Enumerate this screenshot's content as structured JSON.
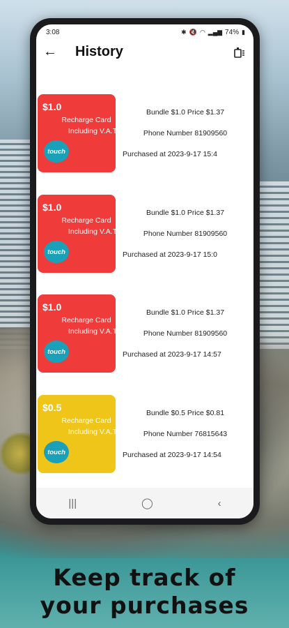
{
  "status": {
    "time": "3:08",
    "battery": "74%"
  },
  "app_bar": {
    "title": "History"
  },
  "purchases": [
    {
      "amount": "$1.0",
      "card_line1": "Recharge Card",
      "card_line2": "Including V.A.T",
      "logo": "touch",
      "color": "#ef3b3a",
      "bundle_price": "Bundle $1.0   Price $1.37",
      "phone": "Phone Number 81909560",
      "purchased": "Purchased at 2023-9-17 15:4"
    },
    {
      "amount": "$1.0",
      "card_line1": "Recharge Card",
      "card_line2": "Including V.A.T",
      "logo": "touch",
      "color": "#ef3b3a",
      "bundle_price": "Bundle $1.0   Price $1.37",
      "phone": "Phone Number 81909560",
      "purchased": "Purchased at 2023-9-17 15:0"
    },
    {
      "amount": "$1.0",
      "card_line1": "Recharge Card",
      "card_line2": "Including V.A.T",
      "logo": "touch",
      "color": "#ef3b3a",
      "bundle_price": "Bundle $1.0   Price $1.37",
      "phone": "Phone Number 81909560",
      "purchased": "Purchased at 2023-9-17 14:57"
    },
    {
      "amount": "$0.5",
      "card_line1": "Recharge Card",
      "card_line2": "Including V.A.T",
      "logo": "touch",
      "color": "#efc51a",
      "bundle_price": "Bundle $0.5   Price $0.81",
      "phone": "Phone Number 76815643",
      "purchased": "Purchased at 2023-9-17 14:54"
    }
  ],
  "caption": {
    "line1": "Keep track of",
    "line2": "your purchases"
  },
  "icons": {
    "back": "arrow-left-icon",
    "clear": "clear-history-icon",
    "recents": "recents-icon",
    "home": "home-icon",
    "back_nav": "back-nav-icon"
  }
}
